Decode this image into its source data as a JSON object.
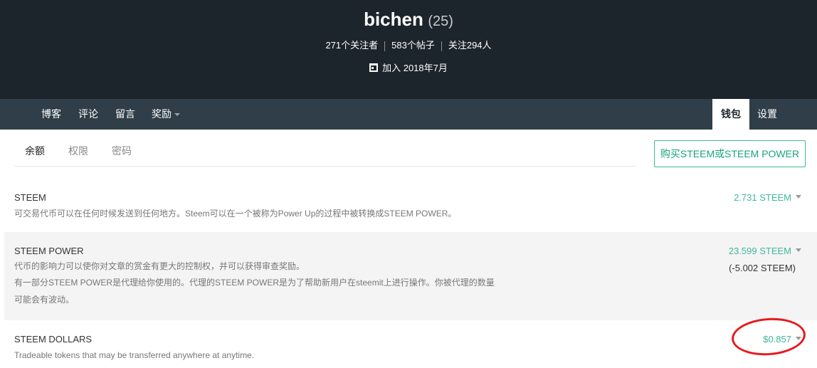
{
  "profile": {
    "username": "bichen",
    "reputation": "(25)",
    "followers": "271个关注者",
    "posts": "583个帖子",
    "following": "关注294人",
    "joined": "加入 2018年7月",
    "joined_icon": "calendar-icon"
  },
  "nav": {
    "blog": "博客",
    "comments": "评论",
    "replies": "留言",
    "rewards": "奖励",
    "wallet": "钱包",
    "settings": "设置"
  },
  "subtabs": {
    "balance": "余额",
    "permissions": "权限",
    "password": "密码"
  },
  "buy_button": "购买STEEM或STEEM POWER",
  "balances": {
    "steem": {
      "title": "STEEM",
      "desc": "可交易代币可以在任何时候发送到任何地方。Steem可以在一个被称为Power Up的过程中被转换成STEEM POWER。",
      "amount": "2.731 STEEM"
    },
    "steem_power": {
      "title": "STEEM POWER",
      "desc1": "代币的影响力可以使你对文章的赏金有更大的控制权，并可以获得审查奖励。",
      "desc2": "有一部分STEEM POWER是代理给你使用的。代理的STEEM POWER是为了帮助新用户在steemit上进行操作。你被代理的数量",
      "desc3": "可能会有波动。",
      "amount": "23.599 STEEM",
      "delegated": "(-5.002 STEEM)"
    },
    "steem_dollars": {
      "title": "STEEM DOLLARS",
      "desc": "Tradeable tokens that may be transferred anywhere at anytime.",
      "amount": "$0.857"
    }
  },
  "colors": {
    "header_bg": "#1c252b",
    "nav_bg": "#2f3e48",
    "accent": "#3fb89a",
    "annotation": "#e8191e"
  }
}
